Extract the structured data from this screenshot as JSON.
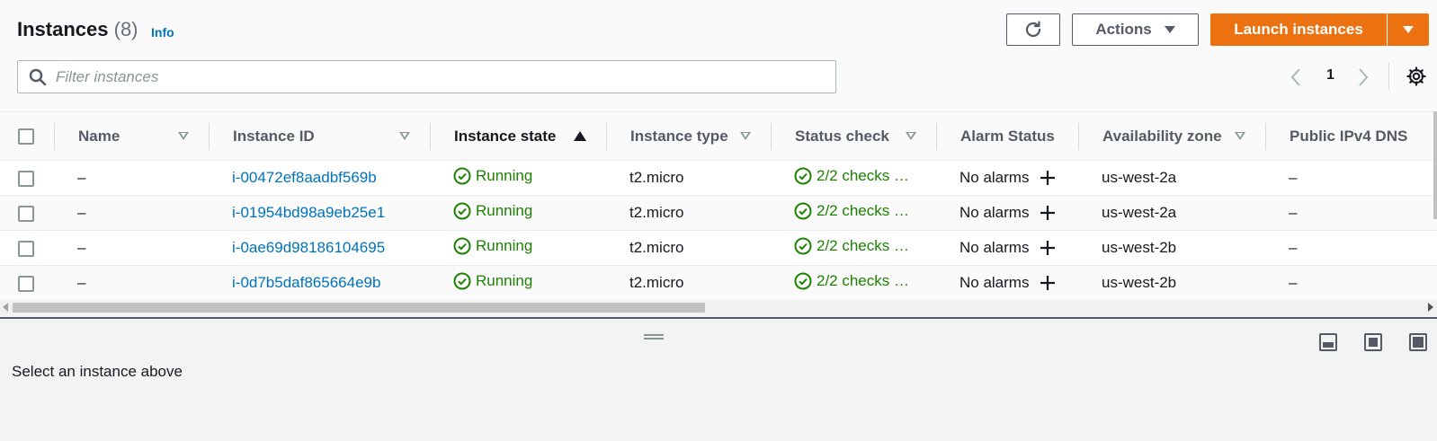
{
  "header": {
    "title": "Instances",
    "count": "(8)",
    "info_label": "Info"
  },
  "toolbar": {
    "refresh_icon": "refresh-icon",
    "actions_label": "Actions",
    "launch_label": "Launch instances"
  },
  "search": {
    "placeholder": "Filter instances",
    "value": ""
  },
  "pagination": {
    "current_page": "1"
  },
  "table": {
    "columns": [
      {
        "label": "Name",
        "sort": "filter"
      },
      {
        "label": "Instance ID",
        "sort": "filter"
      },
      {
        "label": "Instance state",
        "sort": "ascending"
      },
      {
        "label": "Instance type",
        "sort": "filter"
      },
      {
        "label": "Status check",
        "sort": "filter"
      },
      {
        "label": "Alarm Status",
        "sort": "none"
      },
      {
        "label": "Availability zone",
        "sort": "filter"
      },
      {
        "label": "Public IPv4 DNS",
        "sort": "none"
      }
    ],
    "rows": [
      {
        "name": "–",
        "instance_id": "i-00472ef8aadbf569b",
        "state": "Running",
        "type": "t2.micro",
        "status_check": "2/2 checks …",
        "alarm": "No alarms",
        "zone": "us-west-2a",
        "dns": "–"
      },
      {
        "name": "–",
        "instance_id": "i-01954bd98a9eb25e1",
        "state": "Running",
        "type": "t2.micro",
        "status_check": "2/2 checks …",
        "alarm": "No alarms",
        "zone": "us-west-2a",
        "dns": "–"
      },
      {
        "name": "–",
        "instance_id": "i-0ae69d98186104695",
        "state": "Running",
        "type": "t2.micro",
        "status_check": "2/2 checks …",
        "alarm": "No alarms",
        "zone": "us-west-2b",
        "dns": "–"
      },
      {
        "name": "–",
        "instance_id": "i-0d7b5daf865664e9b",
        "state": "Running",
        "type": "t2.micro",
        "status_check": "2/2 checks …",
        "alarm": "No alarms",
        "zone": "us-west-2b",
        "dns": "–"
      }
    ]
  },
  "details_pane": {
    "message": "Select an instance above"
  },
  "colors": {
    "primary_orange": "#ec7211",
    "link_blue": "#0073bb",
    "success_green": "#1d8102"
  }
}
